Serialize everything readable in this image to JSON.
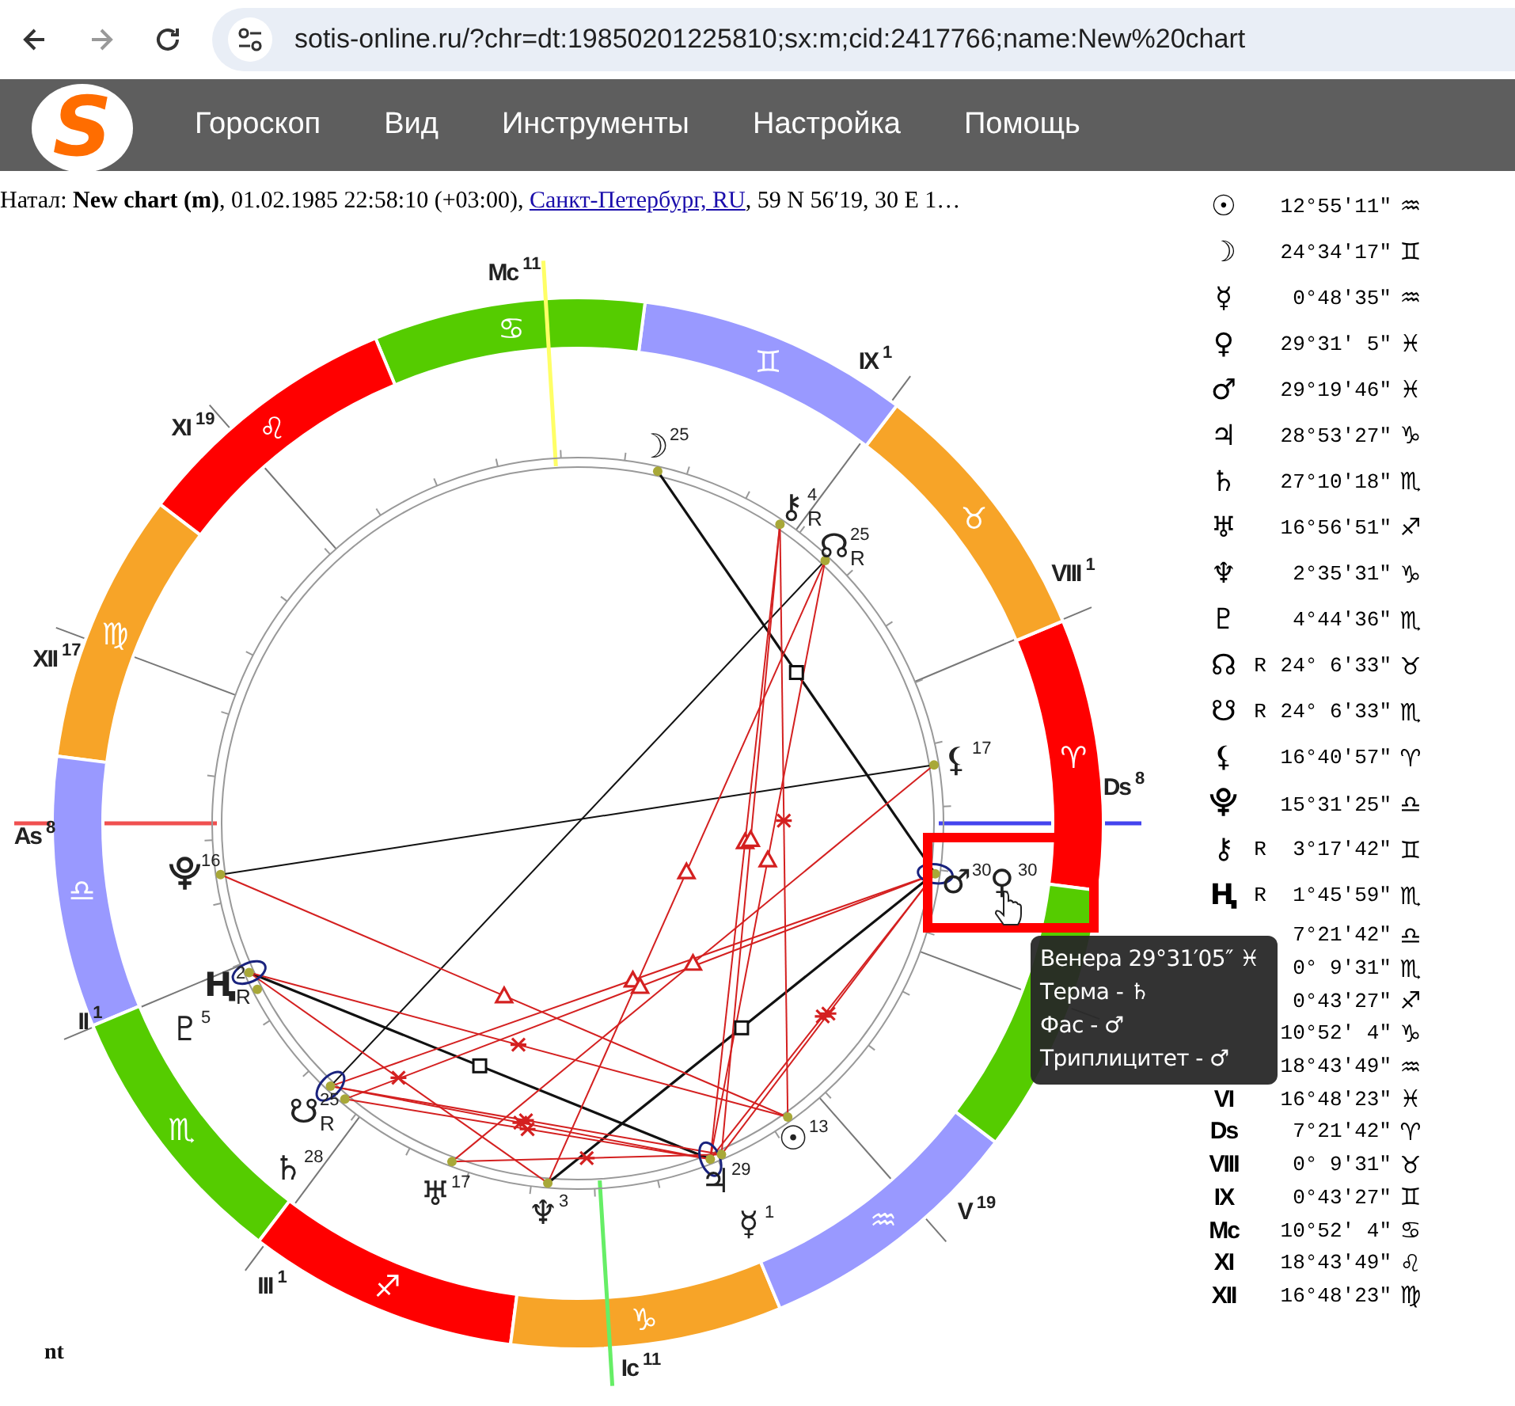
{
  "browser": {
    "url": "sotis-online.ru/?chr=dt:19850201225810;sx:m;cid:2417766;name:New%20chart"
  },
  "logo": "S",
  "menu": [
    "Гороскоп",
    "Вид",
    "Инструменты",
    "Настройка",
    "Помощь"
  ],
  "natal": {
    "text": "Натал: **New chart (m)**, 01.02.1985 22:58:10 (+03:00), ",
    "link": "Санкт-Петербург, RU",
    "rest": ", 59 N 56′19, 30 E 1…"
  },
  "chart": {
    "signs": [
      {
        "glyph": "♈",
        "color": "#ff0000"
      },
      {
        "glyph": "♉",
        "color": "#f7a428"
      },
      {
        "glyph": "♊",
        "color": "#9999ff"
      },
      {
        "glyph": "♋",
        "color": "#55cc00"
      },
      {
        "glyph": "♌",
        "color": "#ff0000"
      },
      {
        "glyph": "♍",
        "color": "#f7a428"
      },
      {
        "glyph": "♎",
        "color": "#9999ff"
      },
      {
        "glyph": "♏",
        "color": "#55cc00"
      },
      {
        "glyph": "♐",
        "color": "#ff0000"
      },
      {
        "glyph": "♑",
        "color": "#f7a428"
      },
      {
        "glyph": "♒",
        "color": "#9999ff"
      },
      {
        "color": "#55cc00"
      }
    ],
    "houses": [
      {
        "label": "As",
        "degree": "8"
      },
      {
        "label": "II",
        "degree": "1"
      },
      {
        "label": "III",
        "degree": "1"
      },
      {
        "label": "Ic",
        "degree": "11"
      },
      {
        "label": "V",
        "degree": "19"
      },
      {
        "label": "Ds",
        "degree": "8"
      },
      {
        "label": "VIII",
        "degree": "1"
      },
      {
        "label": "IX",
        "degree": "1"
      },
      {
        "label": "Mc",
        "degree": "11"
      },
      {
        "label": "XI",
        "degree": "19"
      },
      {
        "label": "XII",
        "degree": "17"
      }
    ],
    "planets": [
      {
        "glyph": "☽",
        "degree": "25"
      },
      {
        "glyph": "⚷",
        "degree": "4",
        "retro": "R"
      },
      {
        "glyph": "☊",
        "degree": "25",
        "retro": "R"
      },
      {
        "glyph": "⚸",
        "degree": "17"
      },
      {
        "glyph": "⯓",
        "degree": "16"
      },
      {
        "glyph": "♂",
        "degree": "30"
      },
      {
        "glyph": "♀",
        "degree": "30"
      },
      {
        "glyph": "Ⱨ",
        "degree": "2",
        "retro": "R"
      },
      {
        "glyph": "♇",
        "degree": "5"
      },
      {
        "glyph": "☋",
        "degree": "25",
        "retro": "R"
      },
      {
        "glyph": "☉",
        "degree": "13"
      },
      {
        "glyph": "♄",
        "degree": "28"
      },
      {
        "glyph": "♃",
        "degree": "29"
      },
      {
        "glyph": "♅",
        "degree": "17"
      },
      {
        "glyph": "♆",
        "degree": "3"
      },
      {
        "glyph": "☿",
        "degree": "1"
      }
    ],
    "fragment": "nt"
  },
  "positions": [
    {
      "symbol": "☉",
      "value": "12°55′11″",
      "sign": "♒"
    },
    {
      "symbol": "☽",
      "value": "24°34′17″",
      "sign": "♊"
    },
    {
      "symbol": "☿",
      "value": "0°48′35″",
      "sign": "♒"
    },
    {
      "symbol": "♀",
      "value": "29°31′ 5″",
      "sign": "♓"
    },
    {
      "symbol": "♂",
      "value": "29°19′46″",
      "sign": "♓"
    },
    {
      "symbol": "♃",
      "value": "28°53′27″",
      "sign": "♑"
    },
    {
      "symbol": "♄",
      "value": "27°10′18″",
      "sign": "♏"
    },
    {
      "symbol": "♅",
      "value": "16°56′51″",
      "sign": "♐"
    },
    {
      "symbol": "♆",
      "value": "2°35′31″",
      "sign": "♑"
    },
    {
      "symbol": "♇",
      "value": "4°44′36″",
      "sign": "♏"
    },
    {
      "symbol": "☊",
      "retro": "R",
      "value": "24° 6′33″",
      "sign": "♉"
    },
    {
      "symbol": "☋",
      "retro": "R",
      "value": "24° 6′33″",
      "sign": "♏"
    },
    {
      "symbol": "⚸",
      "value": "16°40′57″",
      "sign": "♈"
    },
    {
      "symbol": "⯓",
      "value": "15°31′25″",
      "sign": "♎"
    },
    {
      "symbol": "⚷",
      "retro": "R",
      "value": "3°17′42″",
      "sign": "♊"
    },
    {
      "symbol": "Ⱨ",
      "retro": "R",
      "value": "1°45′59″",
      "sign": "♏"
    }
  ],
  "cusps": [
    {
      "value": "7°21′42″",
      "sign": "♎"
    },
    {
      "value": "0° 9′31″",
      "sign": "♏"
    },
    {
      "value": "0°43′27″",
      "sign": "♐"
    },
    {
      "value": "10°52′ 4″",
      "sign": "♑"
    },
    {
      "value": "18°43′49″",
      "sign": "♒"
    },
    {
      "label": "VI",
      "value": "16°48′23″",
      "sign": "♓"
    },
    {
      "label": "Ds",
      "value": "7°21′42″",
      "sign": "♈"
    },
    {
      "label": "VIII",
      "value": "0° 9′31″",
      "sign": "♉"
    },
    {
      "label": "IX",
      "value": "0°43′27″",
      "sign": "♊"
    },
    {
      "label": "Mc",
      "value": "10°52′ 4″",
      "sign": "♋"
    },
    {
      "label": "XI",
      "value": "18°43′49″",
      "sign": "♌"
    },
    {
      "label": "XII",
      "value": "16°48′23″",
      "sign": "♍"
    }
  ],
  "tooltip": [
    "Венера 29°31′05″ ♓",
    "Терма - ♄",
    "Фас - ♂",
    "Триплицитет - ♂"
  ]
}
